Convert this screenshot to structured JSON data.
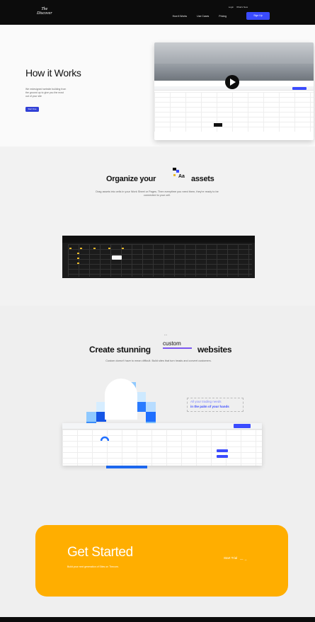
{
  "header": {
    "logo_line1": "The",
    "logo_line2": "Discover",
    "top_links": [
      "Login",
      "What's New"
    ],
    "nav": [
      "How it Works",
      "Use Cases",
      "Pricing"
    ],
    "signup_label": "Sign Up"
  },
  "hero": {
    "title": "How it Works",
    "description": "We redesigned website building from the ground up to give you the most out of your site",
    "button_label": "Start Free"
  },
  "organize": {
    "title": "Organize your",
    "title_end": "assets",
    "aa": "Aa",
    "description": "Drag assets into cells in your Work Sheet or Pages. Then everytime you need them, they're ready to be connected to your cell."
  },
  "create": {
    "title_start": "Create stunning",
    "custom": "custom",
    "title_end": "websites",
    "description": "Custom doesn't have to mean difficult. Build sites that turn heads and convert customers.",
    "trading_line1": "All your trading needs",
    "trading_line2": "in the palm of your hands"
  },
  "get_started": {
    "title": "Get Started",
    "subtitle": "Build your next generation of Sites on Thecorn.",
    "trial_label": "Start Trial"
  },
  "colors": {
    "accent": "#3a4bff",
    "cta_bg": "#ffae00",
    "dark": "#0c0c0c"
  }
}
